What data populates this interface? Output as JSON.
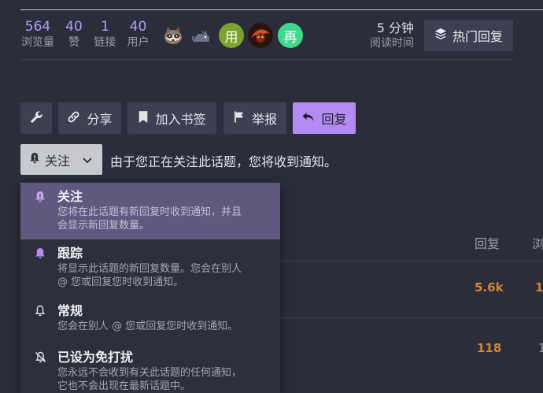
{
  "stats": [
    {
      "value": "564",
      "label": "浏览量"
    },
    {
      "value": "40",
      "label": "赞"
    },
    {
      "value": "1",
      "label": "链接"
    },
    {
      "value": "40",
      "label": "用户"
    }
  ],
  "avatars": {
    "letter_1": "用",
    "letter_2": "再",
    "colors": {
      "green": "#7aa22d",
      "mint": "#3ed98d"
    }
  },
  "read_time": {
    "value": "5 分钟",
    "label": "阅读时间"
  },
  "hot_replies_button": {
    "label": "热门回复",
    "icon": "layers-icon"
  },
  "actions": {
    "tools_icon": "wrench-icon",
    "share": "分享",
    "bookmark": "加入书签",
    "flag": "举报",
    "reply": "回复"
  },
  "notification": {
    "selected": "关注",
    "notice": "由于您正在关注此话题，您将收到通知。"
  },
  "menu": [
    {
      "title": "关注",
      "icon": "bell-dot-icon",
      "desc_lines": [
        "您将在此话题有新回复时收到通知，并且",
        "会显示新回复数量。"
      ]
    },
    {
      "title": "跟踪",
      "icon": "bell-filled-icon",
      "desc_lines": [
        "将显示此话题的新回复数量。您会在别人",
        "@ 您或回复您时收到通知。"
      ]
    },
    {
      "title": "常规",
      "icon": "bell-outline-icon",
      "desc_lines": [
        "您会在别人 @ 您或回复您时收到通知。"
      ]
    },
    {
      "title": "已设为免打扰",
      "icon": "bell-slash-icon",
      "desc_lines": [
        "您永远不会收到有关此话题的任何通知，",
        "它也不会出现在最新话题中。"
      ]
    }
  ],
  "table": {
    "headers": {
      "replies": "回复",
      "views": "浏"
    },
    "rows": [
      {
        "replies": "5.6k",
        "views": "1"
      },
      {
        "replies": "118",
        "views": "1"
      }
    ]
  },
  "colors": {
    "background": "#2b2d3a",
    "accent": "#b48bf2",
    "stat_number": "#b59cf5",
    "hot_number": "#d4843a"
  }
}
